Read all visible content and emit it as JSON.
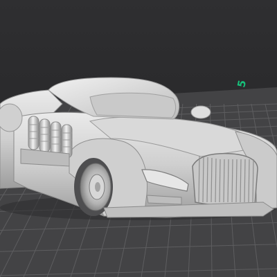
{
  "viewport": {
    "background_color": "#2c2c2d",
    "build_plate_color": "#444446",
    "grid_line_color": "#5e5e60",
    "model_color": "#d6d6d6"
  },
  "build_plate": {
    "axis_label": "5",
    "axis_label_color": "#16c07a"
  },
  "model": {
    "icon": "retro-car-3d-model"
  }
}
